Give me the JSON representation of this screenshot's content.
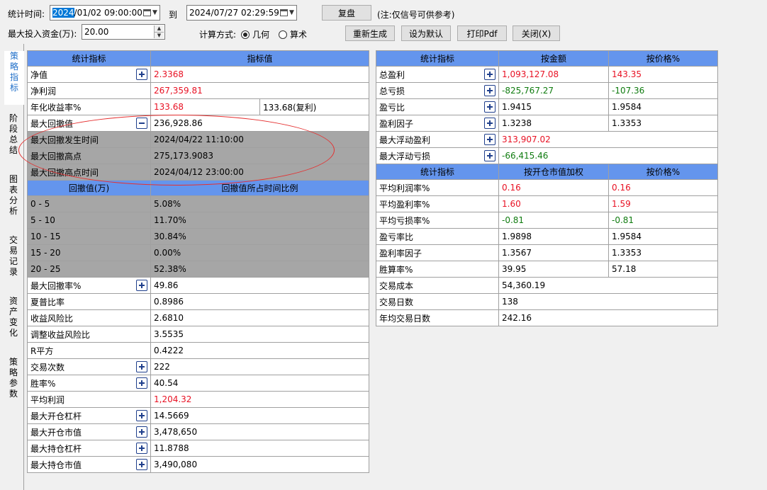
{
  "toolbar": {
    "stat_time_label": "统计时间:",
    "start_date_selected": "2024",
    "start_date_rest": "/01/02 09:00:00",
    "to_label": "到",
    "end_date": "2024/07/27 02:29:59",
    "review_button": "复盘",
    "note": "(注:仅信号可供参考)",
    "max_capital_label": "最大投入资金(万):",
    "max_capital_value": "20.00",
    "calc_method_label": "计算方式:",
    "radio_geometric": "几何",
    "radio_arithmetic": "算术",
    "regenerate_button": "重新生成",
    "set_default_button": "设为默认",
    "print_pdf_button": "打印Pdf",
    "close_button": "关闭(X)"
  },
  "side_tabs": [
    "策略指标",
    "阶段总结",
    "图表分析",
    "交易记录",
    "资产变化",
    "策略参数"
  ],
  "left_table": {
    "headers": [
      "统计指标",
      "指标值"
    ],
    "rows": [
      {
        "name": "净值",
        "value": "2.3368",
        "value_color": "red",
        "expander": "plus"
      },
      {
        "name": "净利润",
        "value": "267,359.81",
        "value_color": "red"
      },
      {
        "name": "年化收益率%",
        "value": "133.68",
        "value_color": "red",
        "extra": "133.68(复利)"
      },
      {
        "name": "最大回撤值",
        "value": "236,928.86",
        "expander": "minus"
      },
      {
        "name": "最大回撤发生时间",
        "value": "2024/04/22 11:10:00",
        "gray": true
      },
      {
        "name": "最大回撤高点",
        "value": "275,173.9083",
        "gray": true
      },
      {
        "name": "最大回撤高点时间",
        "value": "2024/04/12 23:00:00",
        "gray": true
      }
    ],
    "sub_headers": [
      "回撤值(万)",
      "回撤值所占时间比例"
    ],
    "sub_rows": [
      {
        "name": "0 - 5",
        "value": "5.08%"
      },
      {
        "name": "5 - 10",
        "value": "11.70%"
      },
      {
        "name": "10 - 15",
        "value": "30.84%"
      },
      {
        "name": "15 - 20",
        "value": "0.00%"
      },
      {
        "name": "20 - 25",
        "value": "52.38%"
      }
    ],
    "rows2": [
      {
        "name": "最大回撤率%",
        "value": "49.86",
        "expander": "plus"
      },
      {
        "name": "夏普比率",
        "value": "0.8986"
      },
      {
        "name": "收益风险比",
        "value": "2.6810"
      },
      {
        "name": "调整收益风险比",
        "value": "3.5535"
      },
      {
        "name": "R平方",
        "value": "0.4222"
      },
      {
        "name": "交易次数",
        "value": "222",
        "expander": "plus"
      },
      {
        "name": "胜率%",
        "value": "40.54",
        "expander": "plus"
      },
      {
        "name": "平均利润",
        "value": "1,204.32",
        "value_color": "red"
      },
      {
        "name": "最大开仓杠杆",
        "value": "14.5669",
        "expander": "plus"
      },
      {
        "name": "最大开仓市值",
        "value": "3,478,650",
        "expander": "plus"
      },
      {
        "name": "最大持仓杠杆",
        "value": "11.8788",
        "expander": "plus"
      },
      {
        "name": "最大持仓市值",
        "value": "3,490,080",
        "expander": "plus"
      }
    ]
  },
  "right_table": {
    "headers": [
      "统计指标",
      "按金额",
      "按价格%"
    ],
    "rows": [
      {
        "name": "总盈利",
        "amount": "1,093,127.08",
        "amount_color": "red",
        "pct": "143.35",
        "pct_color": "red",
        "expander": "plus"
      },
      {
        "name": "总亏损",
        "amount": "-825,767.27",
        "amount_color": "green",
        "pct": "-107.36",
        "pct_color": "green",
        "expander": "plus"
      },
      {
        "name": "盈亏比",
        "amount": "1.9415",
        "pct": "1.9584",
        "expander": "plus"
      },
      {
        "name": "盈利因子",
        "amount": "1.3238",
        "pct": "1.3353",
        "expander": "plus"
      },
      {
        "name": "最大浮动盈利",
        "amount": "313,907.02",
        "amount_color": "red",
        "pct": "",
        "expander": "plus"
      },
      {
        "name": "最大浮动亏损",
        "amount": "-66,415.46",
        "amount_color": "green",
        "pct": "",
        "expander": "plus"
      }
    ],
    "sub_headers": [
      "统计指标",
      "按开仓市值加权",
      "按价格%"
    ],
    "sub_rows": [
      {
        "name": "平均利润率%",
        "amount": "0.16",
        "amount_color": "red",
        "pct": "0.16",
        "pct_color": "red"
      },
      {
        "name": "平均盈利率%",
        "amount": "1.60",
        "amount_color": "red",
        "pct": "1.59",
        "pct_color": "red"
      },
      {
        "name": "平均亏损率%",
        "amount": "-0.81",
        "amount_color": "green",
        "pct": "-0.81",
        "pct_color": "green"
      },
      {
        "name": "盈亏率比",
        "amount": "1.9898",
        "pct": "1.9584"
      },
      {
        "name": "盈利率因子",
        "amount": "1.3567",
        "pct": "1.3353"
      },
      {
        "name": "胜算率%",
        "amount": "39.95",
        "pct": "57.18"
      },
      {
        "name": "交易成本",
        "amount": "54,360.19",
        "pct": ""
      },
      {
        "name": "交易日数",
        "amount": "138",
        "pct": ""
      },
      {
        "name": "年均交易日数",
        "amount": "242.16",
        "pct": ""
      }
    ]
  },
  "colors": {
    "header_bg": "#6495ed",
    "gray_row_bg": "#a6a6a6",
    "red_value": "#e81123",
    "green_value": "#107c10",
    "active_tab": "#1e6ec8",
    "annotation_ellipse": "#e53030"
  },
  "icons": {
    "expand": "plus-box-icon",
    "collapse": "minus-box-icon",
    "calendar": "calendar-icon",
    "dropdown": "chevron-down-icon"
  }
}
